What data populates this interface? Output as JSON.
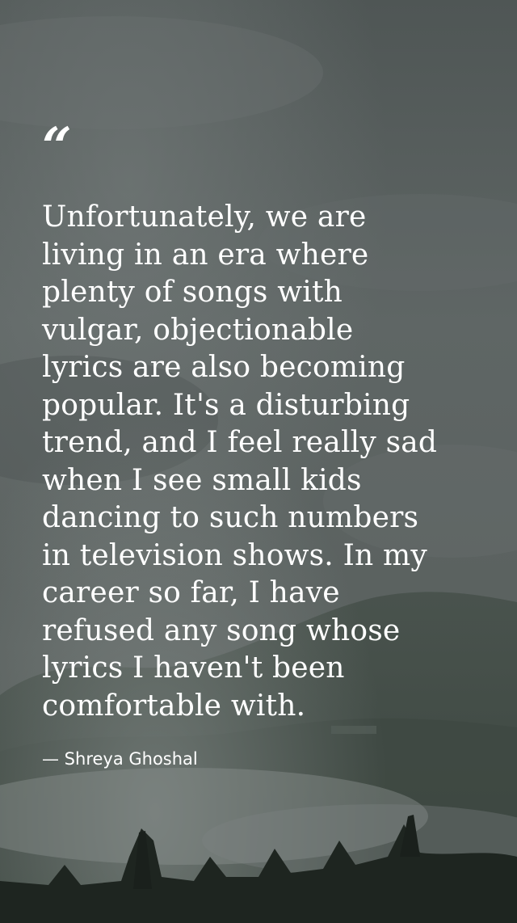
{
  "quote": {
    "mark": "“",
    "text": "Unfortunately, we are\nliving in an era where\nplenty of songs with\nvulgar, objectionable\nlyrics are also becoming\npopular. It's a disturbing\ntrend, and I feel really sad\nwhen I see small kids\ndancing to such numbers\nin television shows. In my\ncareer so far, I have\nrefused any song whose\nlyrics I haven't been\ncomfortable with.",
    "author": "— Shreya Ghoshal"
  },
  "colors": {
    "text": "#ffffff",
    "sky": "#5b6261",
    "hills": "#3c463f",
    "trees": "#1d241f"
  }
}
